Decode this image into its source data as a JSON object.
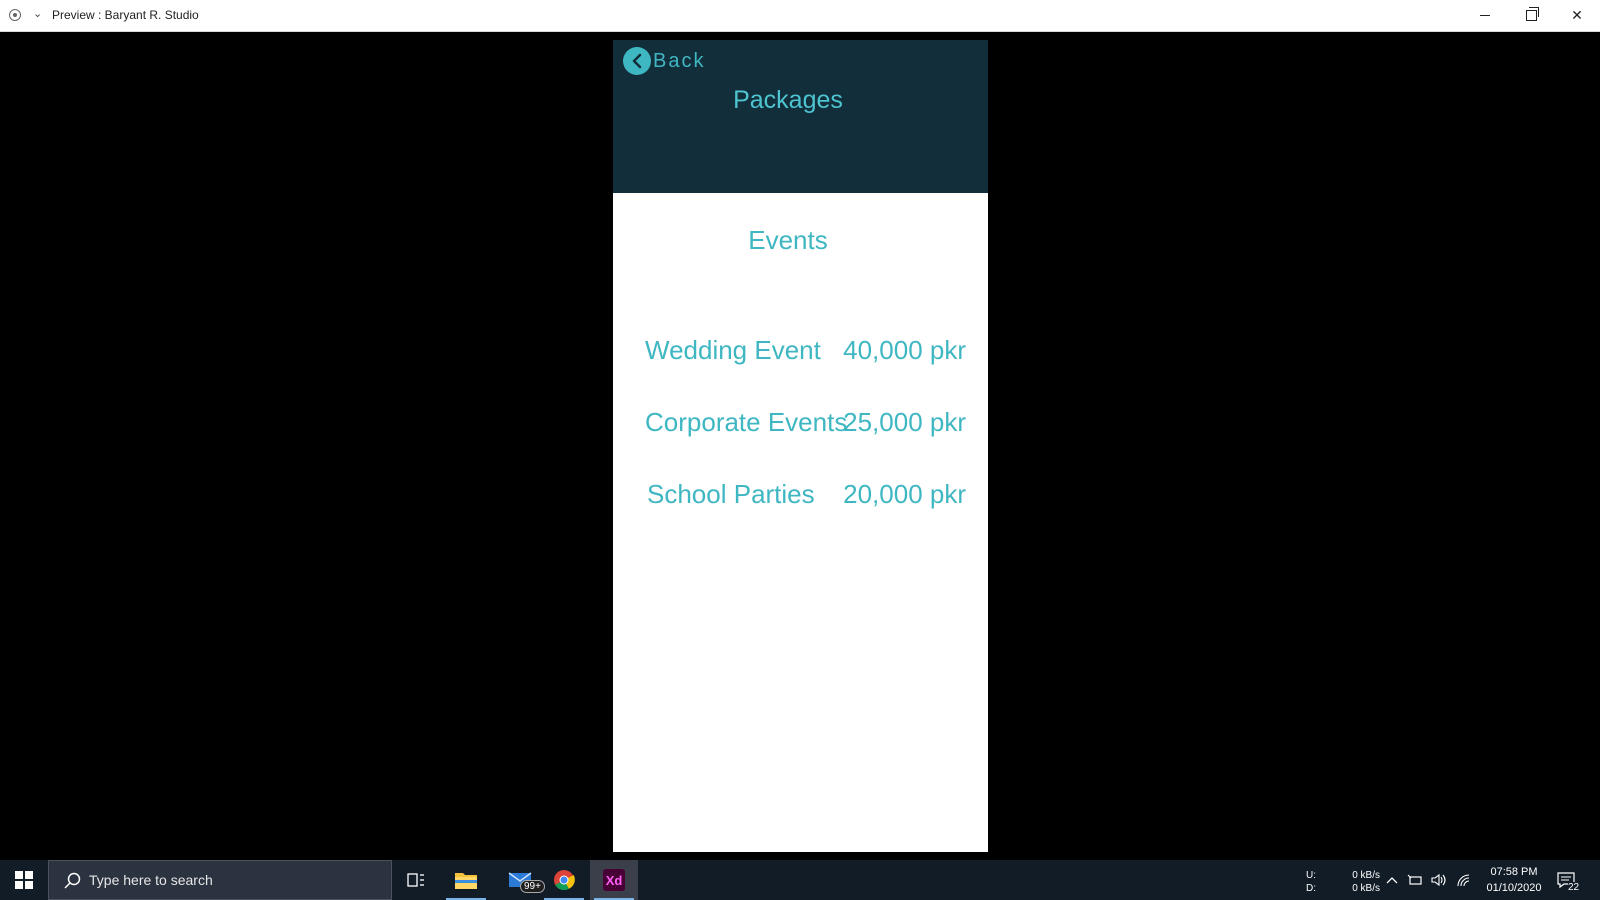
{
  "window": {
    "title": "Preview : Baryant R. Studio"
  },
  "app": {
    "back_label": "Back",
    "header_title": "Packages",
    "section_title": "Events",
    "packages": [
      {
        "name": "Wedding Event",
        "price": "40,000 pkr"
      },
      {
        "name": "Corporate Events",
        "price": "25,000 pkr"
      },
      {
        "name": "School Parties",
        "price": "20,000 pkr"
      }
    ],
    "colors": {
      "header_bg": "#132e3b",
      "accent": "#3fb7c2",
      "page_bg": "#ffffff"
    }
  },
  "taskbar": {
    "search_placeholder": "Type here to search",
    "mail_badge": "99+",
    "xd_label": "Xd",
    "network": {
      "upload_label": "U:",
      "download_label": "D:",
      "upload_value": "0 kB/s",
      "download_value": "0 kB/s"
    },
    "time": "07:58 PM",
    "date": "01/10/2020",
    "notification_count": "22"
  }
}
